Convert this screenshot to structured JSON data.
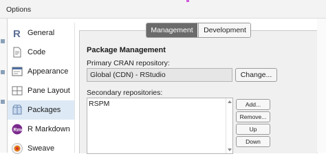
{
  "window": {
    "title": "Options"
  },
  "sidebar": {
    "items": [
      {
        "label": "General",
        "icon": "r-logo-icon"
      },
      {
        "label": "Code",
        "icon": "code-document-icon"
      },
      {
        "label": "Appearance",
        "icon": "appearance-icon"
      },
      {
        "label": "Pane Layout",
        "icon": "pane-layout-icon"
      },
      {
        "label": "Packages",
        "icon": "packages-icon",
        "selected": true
      },
      {
        "label": "R Markdown",
        "icon": "rmarkdown-icon"
      },
      {
        "label": "Sweave",
        "icon": "sweave-icon"
      }
    ]
  },
  "tabs": {
    "management": "Management",
    "development": "Development",
    "active": "Management"
  },
  "package_management": {
    "title": "Package Management",
    "cran_label": "Primary CRAN repository:",
    "cran_value": "Global (CDN) - RStudio",
    "change_label": "Change...",
    "secondary_label": "Secondary repositories:",
    "secondary_repos": [
      "RSPM"
    ],
    "buttons": {
      "add": "Add...",
      "remove": "Remove...",
      "up": "Up",
      "down": "Down"
    }
  },
  "colors": {
    "selected_bg": "#dde9f5",
    "active_tab": "#6b6b6b",
    "rmarkdown": "#7a2a8c",
    "sweave": "#e07b1a"
  }
}
